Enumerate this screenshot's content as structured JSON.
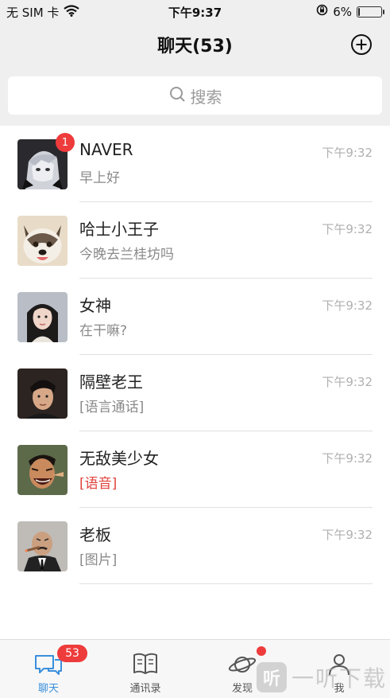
{
  "status_bar": {
    "carrier": "无 SIM 卡",
    "time": "下午9:37",
    "battery_percent": "6%",
    "battery_level": 0.06
  },
  "nav": {
    "title": "聊天(53)"
  },
  "search": {
    "placeholder": "搜索"
  },
  "chats": [
    {
      "name": "NAVER",
      "preview": "早上好",
      "time": "下午9:32",
      "badge": "1",
      "preview_color": "gray",
      "avatar": "anime-avatar"
    },
    {
      "name": "哈士小王子",
      "preview": "今晚去兰桂坊吗",
      "time": "下午9:32",
      "badge": "",
      "preview_color": "gray",
      "avatar": "husky-avatar"
    },
    {
      "name": "女神",
      "preview": "在干嘛?",
      "time": "下午9:32",
      "badge": "",
      "preview_color": "gray",
      "avatar": "girl-avatar"
    },
    {
      "name": "隔壁老王",
      "preview": "[语言通话]",
      "time": "下午9:32",
      "badge": "",
      "preview_color": "gray",
      "avatar": "man-avatar"
    },
    {
      "name": "无敌美少女",
      "preview": "[语音]",
      "time": "下午9:32",
      "badge": "",
      "preview_color": "red",
      "avatar": "laughing-avatar"
    },
    {
      "name": "老板",
      "preview": "[图片]",
      "time": "下午9:32",
      "badge": "",
      "preview_color": "gray",
      "avatar": "boss-avatar"
    }
  ],
  "tabs": [
    {
      "label": "聊天",
      "icon": "chat-bubbles-icon",
      "badge": "53",
      "active": true
    },
    {
      "label": "通讯录",
      "icon": "contacts-book-icon",
      "badge": "",
      "active": false
    },
    {
      "label": "发现",
      "icon": "planet-icon",
      "badge": "dot",
      "active": false
    },
    {
      "label": "我",
      "icon": "person-icon",
      "badge": "",
      "active": false
    }
  ],
  "watermark": {
    "logo_text": "听",
    "text": "一听下载"
  },
  "colors": {
    "accent": "#3a8fdc",
    "badge": "#ee3b3b",
    "header_bg": "#efefef"
  }
}
